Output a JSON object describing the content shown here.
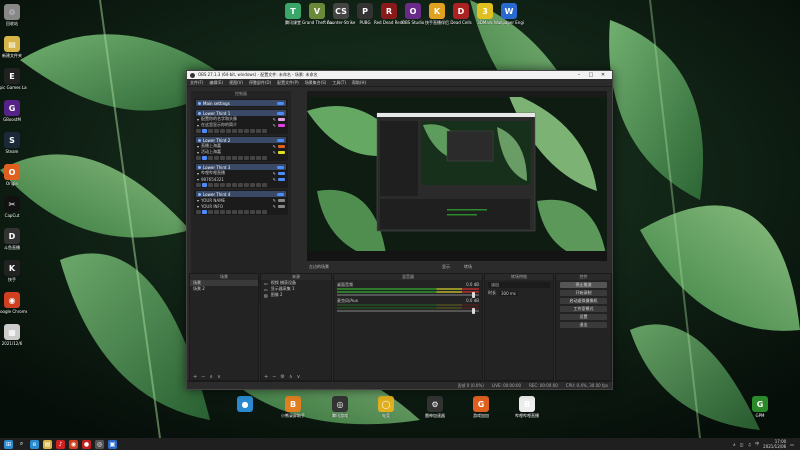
{
  "desktop": {
    "top_icons": [
      {
        "label": "腾讯课堂",
        "icon": "tencent-classroom-icon",
        "color": "#3aa66a",
        "text": "T"
      },
      {
        "label": "Grand Theft Auto V",
        "icon": "gta-icon",
        "color": "#6a8a3a",
        "text": "V"
      },
      {
        "label": "Counter-Strike",
        "icon": "counter-strike-icon",
        "color": "#444444",
        "text": "CS"
      },
      {
        "label": "PUBG",
        "icon": "pubg-icon",
        "color": "#333333",
        "text": "P"
      },
      {
        "label": "Red Dead Redemption",
        "icon": "red-dead-icon",
        "color": "#8a1a1a",
        "text": "R"
      },
      {
        "label": "OBS Studio",
        "icon": "obs-icon",
        "color": "#6a2a8a",
        "text": "O"
      },
      {
        "label": "快手直播伴侣",
        "icon": "kuaishou-icon",
        "color": "#e0a020",
        "text": "K"
      },
      {
        "label": "Dead Cells",
        "icon": "dead-cells-icon",
        "color": "#aa2222",
        "text": "D"
      },
      {
        "label": "3DMark",
        "icon": "3dmark-icon",
        "color": "#e0c020",
        "text": "3"
      },
      {
        "label": "Wallpaper Engine",
        "icon": "wallpaper-engine-icon",
        "color": "#2a6ad0",
        "text": "W"
      }
    ],
    "left_icons": [
      {
        "label": "回收站",
        "icon": "recycle-bin-icon",
        "color": "#888888",
        "text": "♲"
      },
      {
        "label": "新建文件夹",
        "icon": "folder-icon",
        "color": "#d6b44a",
        "text": "▤"
      },
      {
        "label": "Epic Games Launcher",
        "icon": "epic-games-icon",
        "color": "#222222",
        "text": "E"
      },
      {
        "label": "GBoostM",
        "icon": "gboost-icon",
        "color": "#552288",
        "text": "G"
      },
      {
        "label": "Steam",
        "icon": "steam-icon",
        "color": "#1b2838",
        "text": "S"
      },
      {
        "label": "Origin",
        "icon": "origin-icon",
        "color": "#e06020",
        "text": "O"
      },
      {
        "label": "CapCut",
        "icon": "capcut-icon",
        "color": "#111111",
        "text": "✂"
      },
      {
        "label": "斗鱼直播",
        "icon": "douyu-icon",
        "color": "#333333",
        "text": "D"
      },
      {
        "label": "快手",
        "icon": "kuaishou-left-icon",
        "color": "#222222",
        "text": "K"
      },
      {
        "label": "Google Chrome",
        "icon": "chrome-icon",
        "color": "#d04020",
        "text": "◉"
      },
      {
        "label": "2021/12/6",
        "icon": "screenshot-file-icon",
        "color": "#cccccc",
        "text": "▦"
      }
    ],
    "bottom_icons": [
      {
        "label": "",
        "icon": "chat-app-icon",
        "color": "#2a8ad0",
        "text": "●"
      },
      {
        "label": "小熊录屏助手",
        "icon": "bear-recorder-icon",
        "color": "#e08020",
        "text": "B"
      },
      {
        "label": "腾讯游戏",
        "icon": "tencent-games-icon",
        "color": "#333333",
        "text": "◎"
      },
      {
        "label": "电竞",
        "icon": "esports-icon",
        "color": "#e0b020",
        "text": "◯"
      },
      {
        "label": "雷神加速器",
        "icon": "thor-accelerator-icon",
        "color": "#333333",
        "text": "⚙"
      },
      {
        "label": "游戏加加",
        "icon": "gameplus-icon",
        "color": "#e06020",
        "text": "G"
      },
      {
        "label": "哔哩哔哩直播",
        "icon": "bilibili-live-icon",
        "color": "#eeeeee",
        "text": "B"
      }
    ],
    "right_icon": {
      "label": "GPM",
      "icon": "gpm-icon",
      "color": "#2a8a2a",
      "text": "G"
    }
  },
  "obs": {
    "title": "OBS 27.1.3 (64-bit, windows) - 配置文件: 未命名 - 场景: 未命名",
    "menu": [
      "文件(F)",
      "编辑(E)",
      "视图(V)",
      "停靠部件(D)",
      "配置文件(P)",
      "场景集合(S)",
      "工具(T)",
      "帮助(H)"
    ],
    "dock_left_title": "控制器",
    "cards": [
      {
        "title": "Main settings",
        "rows": []
      },
      {
        "title": "Lower Third 1",
        "rows": [
          {
            "text": "配置你的名字和头像",
            "color": "#e0a0e0"
          },
          {
            "text": "在这里显示你的简介",
            "color": "#e040e0"
          }
        ]
      },
      {
        "title": "Lower Third 2",
        "rows": [
          {
            "text": "直播上海嘉",
            "color": "#e06020"
          },
          {
            "text": "活动上海嘉",
            "color": "#e0e020"
          }
        ]
      },
      {
        "title": "Lower Third 3",
        "rows": [
          {
            "text": "哔哩哔哩直播",
            "color": "#4c8cff"
          },
          {
            "text": "987654321",
            "color": "#4c8cff"
          }
        ]
      },
      {
        "title": "Lower Third 4",
        "rows": [
          {
            "text": "YOUR NAME",
            "color": "#888888"
          },
          {
            "text": "YOUR INFO",
            "color": "#888888"
          }
        ]
      }
    ],
    "scene_label": "左边的场景",
    "studio_buttons": [
      "显示",
      "转场"
    ],
    "docks": {
      "scenes": {
        "title": "场景",
        "items": [
          "场景",
          "场景 2"
        ]
      },
      "sources": {
        "title": "来源",
        "items": [
          "视频 捕获设备",
          "显示器采集 1",
          "图像 2"
        ]
      },
      "mixer": {
        "title": "混音器",
        "channels": [
          {
            "name": "桌面音频",
            "db": "0.0 dB"
          },
          {
            "name": "麦克风/Aux",
            "db": "0.0 dB"
          }
        ]
      },
      "transitions": {
        "title": "转场特效",
        "type": "淡出",
        "duration_label": "时长",
        "duration": "300 ms"
      },
      "controls": {
        "title": "控件",
        "buttons": [
          "停止推流",
          "开始录制",
          "启动虚拟摄像机",
          "工作室模式",
          "设置",
          "退出"
        ]
      }
    },
    "status": [
      "丢帧 0 (0.0%)",
      "LIVE: 00:00:00",
      "REC: 00:00:00",
      "CPU: 0.4%, 30.00 fps"
    ]
  },
  "taskbar": {
    "apps": [
      {
        "icon": "windows-start-icon",
        "color": "#2a8ad0",
        "text": "⊞"
      },
      {
        "icon": "search-icon",
        "color": "#1f1f1f",
        "text": "⌕"
      },
      {
        "icon": "edge-icon",
        "color": "#2a8ad0",
        "text": "e"
      },
      {
        "icon": "file-explorer-icon",
        "color": "#d6b44a",
        "text": "▤"
      },
      {
        "icon": "netease-music-icon",
        "color": "#d02020",
        "text": "♪"
      },
      {
        "icon": "chrome-taskbar-icon",
        "color": "#d04020",
        "text": "◉"
      },
      {
        "icon": "app-red-icon",
        "color": "#c02020",
        "text": "●"
      },
      {
        "icon": "obs-taskbar-icon",
        "color": "#555555",
        "text": "◎"
      },
      {
        "icon": "store-icon",
        "color": "#2a6ad0",
        "text": "▣"
      }
    ],
    "language": "中",
    "time": "17:00",
    "date": "2021/12/06"
  }
}
